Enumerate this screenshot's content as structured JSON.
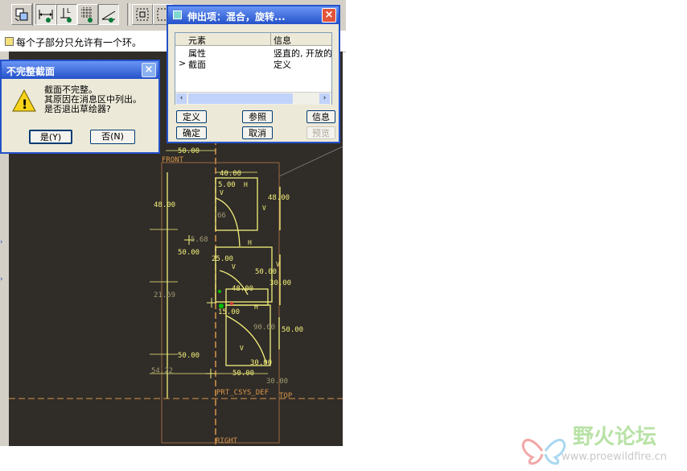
{
  "message_bar": {
    "text": "每个子部分只允许有一个环。"
  },
  "incomplete_dialog": {
    "title": "不完整截面",
    "lines": [
      "截面不完整。",
      "其原因在消息区中列出。",
      "是否退出草绘器?"
    ],
    "yes_label": "是(Y)",
    "no_label": "否(N)"
  },
  "feature_dialog": {
    "title": "伸出项：混合，旋转...",
    "columns": [
      "元素",
      "信息"
    ],
    "rows": [
      {
        "marker": "",
        "element": "属性",
        "info": "竖直的, 开放的"
      },
      {
        "marker": ">",
        "element": "截面",
        "info": "定义"
      }
    ],
    "buttons": {
      "define": "定义",
      "reference": "参照",
      "info": "信息",
      "ok": "确定",
      "cancel": "取消",
      "preview": "预览"
    }
  },
  "sketch": {
    "dimensions": [
      "50.00",
      "40.00",
      "5.00",
      "48.00",
      "48.00",
      "5.68",
      "50.00",
      "25.00",
      "50.00",
      "30.00",
      "48.00",
      "15.00",
      "90.00",
      "50.00",
      "50.00",
      "30.00",
      "54.22",
      "50.00",
      "30.00",
      "21.59",
      "66"
    ],
    "labels": {
      "front": "FRONT",
      "right": "RIGHT",
      "top": "TOP",
      "csys": "PRT_CSYS_DEF",
      "h": "H",
      "v": "V"
    }
  },
  "watermark": {
    "name": "野火论坛",
    "url": "www.proewildfire.cn"
  },
  "colors": {
    "canvas": "#302c28",
    "sketch": "#f2f07a",
    "datum": "#d9964a",
    "title_bar": "#2452c9"
  }
}
